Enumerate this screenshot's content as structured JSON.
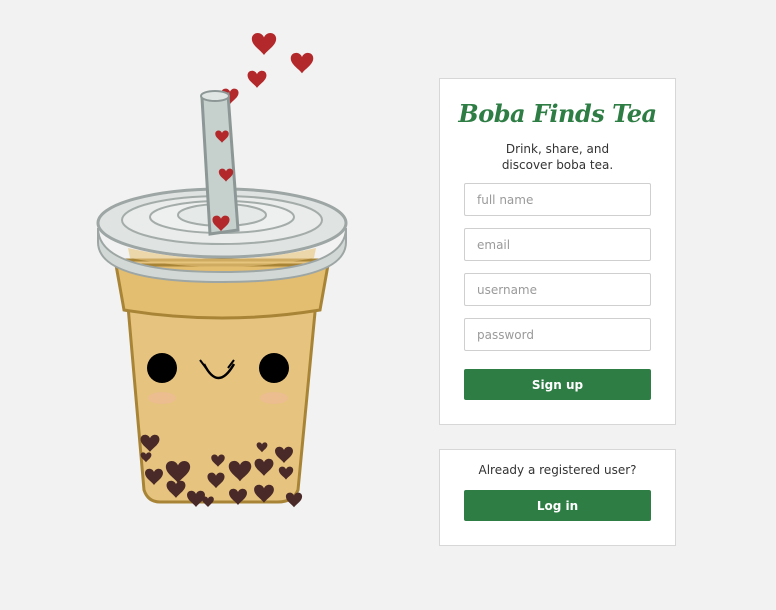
{
  "illustration": {
    "name": "boba-cup-mascot"
  },
  "signup": {
    "title": "Boba Finds Tea",
    "tagline": "Drink, share, and discover boba tea.",
    "fields": [
      {
        "placeholder": "full name"
      },
      {
        "placeholder": "email"
      },
      {
        "placeholder": "username"
      },
      {
        "placeholder": "password"
      }
    ],
    "submit_label": "Sign up"
  },
  "login": {
    "prompt": "Already a registered user?",
    "button_label": "Log in"
  },
  "colors": {
    "brand_green": "#2e7d44",
    "background": "#f2f2f2",
    "heart_red": "#b3292b"
  }
}
